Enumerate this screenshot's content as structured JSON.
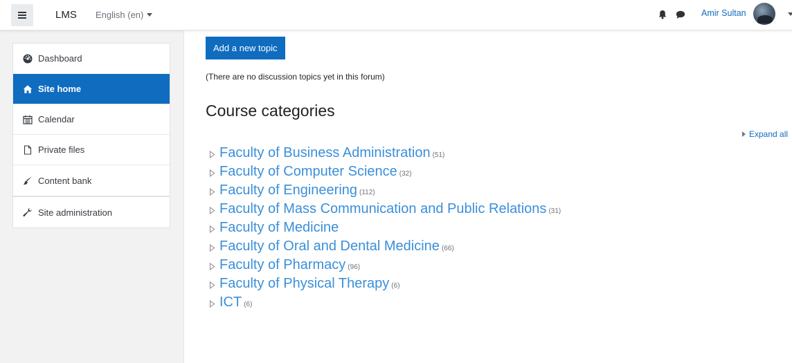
{
  "navbar": {
    "brand": "LMS",
    "language": "English (en)",
    "user_name": "Amir Sultan"
  },
  "sidebar": {
    "items": [
      {
        "label": "Dashboard",
        "icon": "tachometer-icon"
      },
      {
        "label": "Site home",
        "icon": "home-icon",
        "active": true
      },
      {
        "label": "Calendar",
        "icon": "calendar-icon"
      },
      {
        "label": "Private files",
        "icon": "file-icon"
      },
      {
        "label": "Content bank",
        "icon": "paintbrush-icon"
      }
    ],
    "admin": {
      "label": "Site administration",
      "icon": "wrench-icon"
    }
  },
  "main": {
    "add_topic_label": "Add a new topic",
    "no_topics_text": "(There are no discussion topics yet in this forum)",
    "section_title": "Course categories",
    "expand_all": "Expand all",
    "categories": [
      {
        "name": "Faculty of Business Administration",
        "count": "(51)"
      },
      {
        "name": "Faculty of Computer Science",
        "count": "(32)"
      },
      {
        "name": "Faculty of Engineering",
        "count": "(112)"
      },
      {
        "name": "Faculty of Mass Communication and Public Relations",
        "count": "(31)"
      },
      {
        "name": "Faculty of Medicine",
        "count": ""
      },
      {
        "name": "Faculty of Oral and Dental Medicine",
        "count": "(66)"
      },
      {
        "name": "Faculty of Pharmacy",
        "count": "(96)"
      },
      {
        "name": "Faculty of Physical Therapy",
        "count": "(6)"
      },
      {
        "name": "ICT",
        "count": "(6)"
      }
    ]
  },
  "colors": {
    "primary": "#0f6cbf",
    "category_link": "#3a8fd9"
  }
}
